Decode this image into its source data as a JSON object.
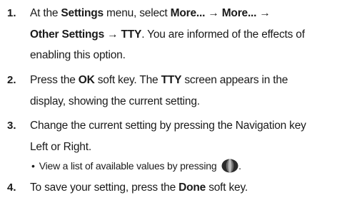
{
  "steps": [
    {
      "number": "1.",
      "parts": {
        "t1": "At the ",
        "b1": "Settings",
        "t2": " menu, select ",
        "b2": "More... → More... →",
        "b3": "Other Settings → TTY",
        "t3": ". You are informed of the effects of",
        "t4": "enabling this option."
      }
    },
    {
      "number": "2.",
      "parts": {
        "t1": "Press the ",
        "b1": "OK",
        "t2": " soft key. The ",
        "b2": "TTY",
        "t3": " screen appears in the",
        "t4": "display, showing the current setting."
      }
    },
    {
      "number": "3.",
      "parts": {
        "t1": "Change the current setting by pressing the Navigation key",
        "t2": "Left or Right."
      }
    },
    {
      "number": "4.",
      "parts": {
        "t1": "To save your setting, press the ",
        "b1": "Done",
        "t2": " soft key."
      }
    }
  ],
  "sub_bullet": {
    "bullet": "•",
    "text": "View a list of available values by pressing",
    "icon": "navigation-key-icon",
    "after": "."
  }
}
